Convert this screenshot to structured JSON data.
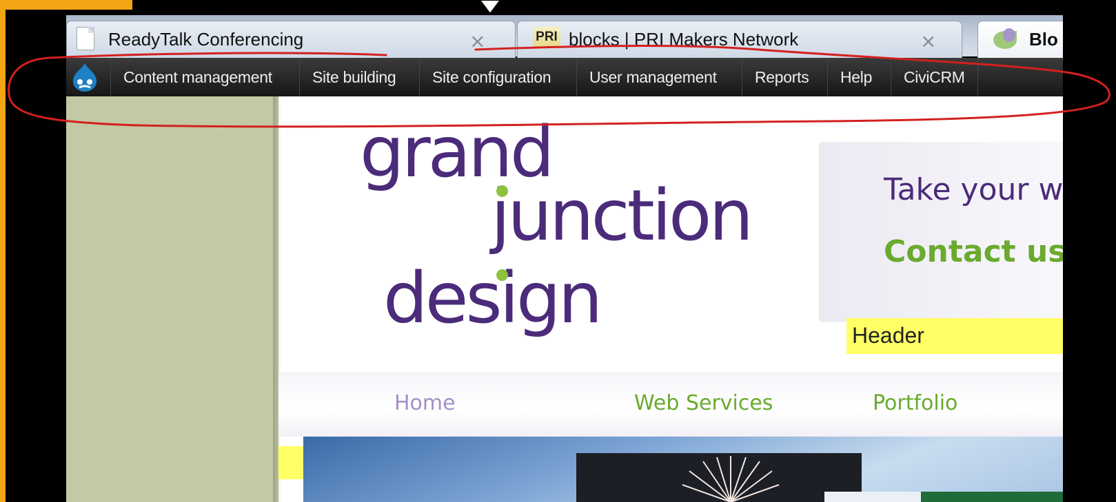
{
  "browser": {
    "tabs": [
      {
        "title": "ReadyTalk Conferencing",
        "icon": "page-icon",
        "close": "×"
      },
      {
        "title": "blocks | PRI Makers Network",
        "icon_text": "PRI",
        "close": "×"
      },
      {
        "title": "Blo",
        "icon": "leaf-icon"
      }
    ]
  },
  "admin_menu": {
    "logo": "drupal-logo-icon",
    "items": [
      "Content management",
      "Site building",
      "Site configuration",
      "User management",
      "Reports",
      "Help",
      "CiviCRM"
    ]
  },
  "site": {
    "logo": {
      "line1": "grand",
      "line2": "junction",
      "line3": "design"
    },
    "cta": {
      "line1": "Take your w",
      "line2": "Contact us"
    },
    "header_region_label": "Header",
    "nav": [
      "Home",
      "Web Services",
      "Portfolio"
    ]
  },
  "colors": {
    "brand_purple": "#4b2b7a",
    "brand_green": "#6aaa2e",
    "annotation_red": "#d42020",
    "frame_orange": "#f2a614",
    "region_yellow": "#ffff66",
    "sidebar": "#c3c9a4"
  }
}
